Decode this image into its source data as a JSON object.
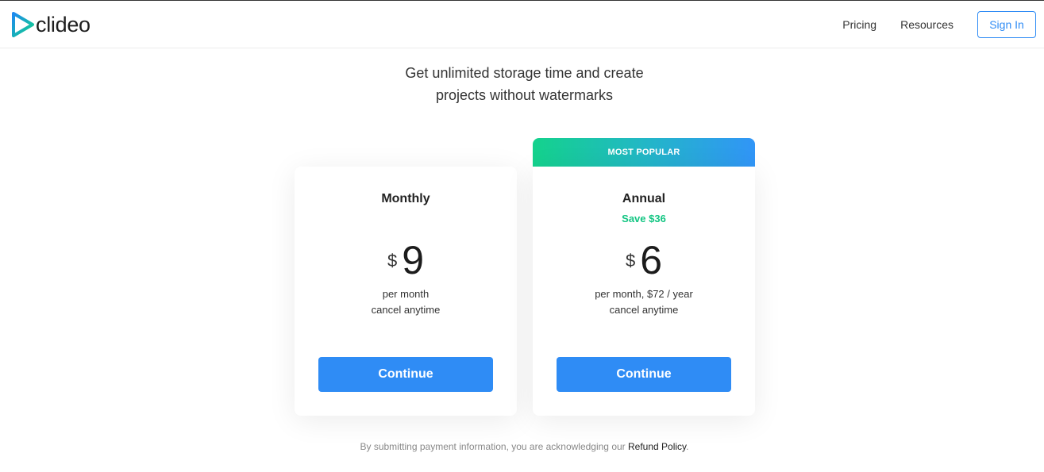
{
  "header": {
    "logo_text": "clideo",
    "nav": {
      "pricing": "Pricing",
      "resources": "Resources",
      "sign_in": "Sign In"
    }
  },
  "headline": {
    "line1": "Get unlimited storage time and create",
    "line2": "projects without watermarks"
  },
  "plans": {
    "monthly": {
      "name": "Monthly",
      "currency": "$",
      "amount": "9",
      "desc_line1": "per month",
      "desc_line2": "cancel anytime",
      "button": "Continue"
    },
    "annual": {
      "badge": "MOST POPULAR",
      "name": "Annual",
      "save": "Save $36",
      "currency": "$",
      "amount": "6",
      "desc_line1": "per month, $72 / year",
      "desc_line2": "cancel anytime",
      "button": "Continue"
    }
  },
  "footer": {
    "note_prefix": "By submitting payment information, you are acknowledging our ",
    "refund_link": "Refund Policy",
    "note_suffix": "."
  },
  "colors": {
    "accent_blue": "#2f8cf5",
    "save_green": "#12c582",
    "gradient_start": "#14d28c",
    "gradient_end": "#3195f7"
  },
  "icons": {
    "logo": "play-triangle-logo-icon"
  }
}
